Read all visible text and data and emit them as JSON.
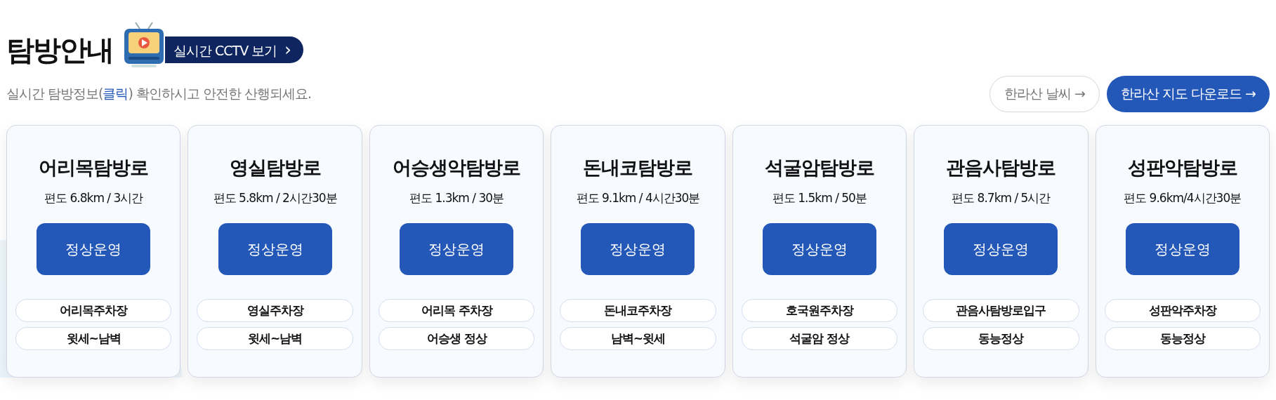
{
  "header": {
    "title": "탐방안내",
    "cctv_button": {
      "label": "실시간 CCTV 보기",
      "arrow": "›"
    },
    "subtitle": {
      "before": "실시간 탐방정보(",
      "link": "클릭",
      "after": ") 확인하시고 안전한 산행되세요."
    },
    "buttons": [
      {
        "label": "한라산 날씨 →",
        "kind": "outline"
      },
      {
        "label": "한라산 지도 다운로드 →",
        "kind": "primary"
      }
    ]
  },
  "trails": [
    {
      "name": "어리목탐방로",
      "info": "편도 6.8km / 3시간",
      "status": "정상운영",
      "points": [
        "어리목주차장",
        "윗세~남벽"
      ]
    },
    {
      "name": "영실탐방로",
      "info": "편도 5.8km / 2시간30분",
      "status": "정상운영",
      "points": [
        "영실주차장",
        "윗세~남벽"
      ]
    },
    {
      "name": "어승생악탐방로",
      "info": "편도 1.3km / 30분",
      "status": "정상운영",
      "points": [
        "어리목 주차장",
        "어승생 정상"
      ]
    },
    {
      "name": "돈내코탐방로",
      "info": "편도 9.1km / 4시간30분",
      "status": "정상운영",
      "points": [
        "돈내코주차장",
        "남벽~윗세"
      ]
    },
    {
      "name": "석굴암탐방로",
      "info": "편도 1.5km / 50분",
      "status": "정상운영",
      "points": [
        "호국원주차장",
        "석굴암 정상"
      ]
    },
    {
      "name": "관음사탐방로",
      "info": "편도 8.7km / 5시간",
      "status": "정상운영",
      "points": [
        "관음사탐방로입구",
        "동능정상"
      ]
    },
    {
      "name": "성판악탐방로",
      "info": "편도 9.6km/4시간30분",
      "status": "정상운영",
      "points": [
        "성판악주차장",
        "동능정상"
      ]
    }
  ]
}
